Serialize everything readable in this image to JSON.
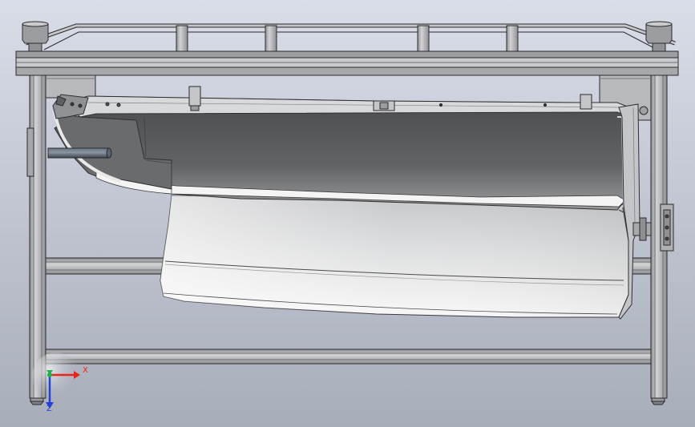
{
  "viewport": {
    "background_top": "#d7dbe6",
    "background_bottom": "#a9aebb",
    "frame_color": "#b4b6bb",
    "frame_edge": "#2a2a2a",
    "part_dark": "#555558",
    "part_light": "#ffffff"
  },
  "triad": {
    "x_label": "X",
    "z_label": "Z",
    "x_color": "#e8241c",
    "y_color": "#22b14c",
    "z_color": "#2440d8"
  }
}
